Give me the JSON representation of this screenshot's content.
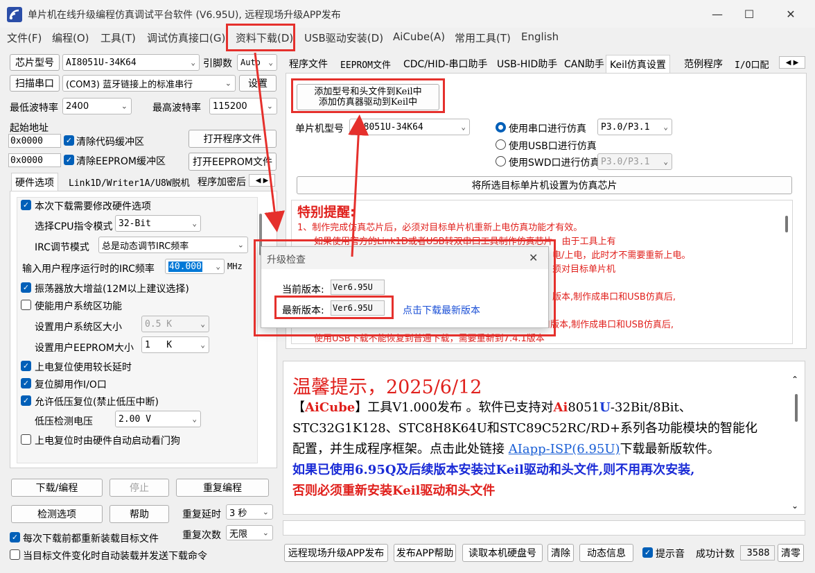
{
  "window": {
    "title": "单片机在线升级编程仿真调试平台软件 (V6.95U), 远程现场升级APP发布",
    "min": "—",
    "max": "☐",
    "close": "✕"
  },
  "menu": [
    "文件(F)",
    "编程(O)",
    "工具(T)",
    "调试仿真接口(G)",
    "资料下载(D)",
    "USB驱动安装(D)",
    "AiCube(A)",
    "常用工具(T)",
    "English"
  ],
  "left": {
    "chip_btn": "芯片型号",
    "chip_value": "AI8051U-34K64",
    "pin_label": "引脚数",
    "pin_value": "Auto",
    "scan_btn": "扫描串口",
    "port_value": "(COM3) 蓝牙链接上的标准串行",
    "settings_btn": "设置",
    "min_baud_label": "最低波特率",
    "min_baud": "2400",
    "max_baud_label": "最高波特率",
    "max_baud": "115200",
    "start_addr_label": "起始地址",
    "addr1": "0x0000",
    "clear_code": "清除代码缓冲区",
    "open_prog": "打开程序文件",
    "addr2": "0x0000",
    "clear_eeprom": "清除EEPROM缓冲区",
    "open_eeprom": "打开EEPROM文件",
    "tabs": [
      "硬件选项",
      "Link1D/Writer1A/U8W脱机",
      "程序加密后"
    ],
    "hw": {
      "need_modify": "本次下载需要修改硬件选项",
      "cpu_mode_label": "选择CPU指令模式",
      "cpu_mode": "32-Bit",
      "irc_mode_label": "IRC调节模式",
      "irc_mode": "总是动态调节IRC频率",
      "irc_freq_label": "输入用户程序运行时的IRC频率",
      "irc_freq": "40.000",
      "irc_unit": "MHz",
      "osc_gain": "振荡器放大增益(12M以上建议选择)",
      "user_sys": "使能用户系统区功能",
      "user_sys_size_label": "设置用户系统区大小",
      "user_sys_size": "0.5 K",
      "user_eeprom_label": "设置用户EEPROM大小",
      "user_eeprom": "1   K",
      "long_delay": "上电复位使用较长延时",
      "reset_io": "复位脚用作I/O口",
      "lvr": "允许低压复位(禁止低压中断)",
      "lvd_label": "低压检测电压",
      "lvd": "2.00 V",
      "watchdog": "上电复位时由硬件自动启动看门狗"
    },
    "download_btn": "下载/编程",
    "stop_btn": "停止",
    "reprog_btn": "重复编程",
    "detect_btn": "检测选项",
    "help_btn": "帮助",
    "repeat_delay_label": "重复延时",
    "repeat_delay": "3 秒",
    "repeat_count_label": "重复次数",
    "repeat_count": "无限",
    "reload_each": "每次下载前都重新装载目标文件",
    "auto_reload": "当目标文件变化时自动装载并发送下载命令"
  },
  "right": {
    "tabs": [
      "程序文件",
      "EEPROM文件",
      "CDC/HID-串口助手",
      "USB-HID助手",
      "CAN助手",
      "Keil仿真设置",
      "范例程序",
      "I/O口配"
    ],
    "keil": {
      "add_btn_line1": "添加型号和头文件到Keil中",
      "add_btn_line2": "添加仿真器驱动到Keil中",
      "mcu_label": "单片机型号",
      "mcu_value": "AI8051U-34K64",
      "sim_serial": "使用串口进行仿真",
      "serial_pins": "P3.0/P3.1",
      "sim_usb": "使用USB口进行仿真",
      "sim_swd": "使用SWD口进行仿真",
      "swd_pins": "P3.0/P3.1",
      "set_chip_btn": "将所选目标单片机设置为仿真芯片",
      "notice_title": "特别提醒:",
      "notice_lines": [
        "1、制作完成仿真芯片后，必须对目标单片机重新上电仿真功能才有效。",
        "如果使用官方的Link1D或者USB转双串口工具制作仿真芯片，由于工具上有",
        "电/上电，此时才不需要重新上电。",
        "须对目标单片机",
        "版本,制作成串口和USB仿真后,",
        "口版本,制作成串口和USB仿真后,",
        "使用USB下载不能恢复到普通下载，需要重新到7.4.1版本"
      ]
    },
    "tip": {
      "title": "温馨提示，2025/6/12",
      "line1_prefix": "【",
      "line1_brand": "AiCube",
      "line1_rest": "】工具V1.000发布 。软件已支持对",
      "line1_ai": "Ai",
      "line1_num": "8051",
      "line1_u": "U",
      "line1_tail": "-32Bit/8Bit、",
      "line2": "STC32G1K128、STC8H8K64U和STC89C52RC/RD+系列各功能模块的智能化",
      "line3_prefix": "配置，并生成程序框架。点击此处链接 ",
      "line3_link": "AIapp-ISP(6.95U)",
      "line3_suffix": "下载最新版软件。",
      "line4": "如果已使用6.95Q及后续版本安装过Keil驱动和头文件,则不用再次安装,",
      "line5": "否则必须重新安装Keil驱动和头文件"
    },
    "bottom": {
      "remote_btn": "远程现场升级APP发布",
      "publish_help_btn": "发布APP帮助",
      "read_disk_btn": "读取本机硬盘号",
      "clear_btn": "清除",
      "dynamic_btn": "动态信息",
      "beep": "提示音",
      "success_label": "成功计数",
      "success_count": "3588",
      "reset_btn": "清零"
    }
  },
  "dialog": {
    "title": "升级检查",
    "current_label": "当前版本:",
    "current_value": "Ver6.95U",
    "latest_label": "最新版本:",
    "latest_value": "Ver6.95U",
    "download_link": "点击下载最新版本",
    "close": "✕"
  },
  "colors": {
    "accent": "#005fb8",
    "annotation_red": "#e5302c"
  }
}
